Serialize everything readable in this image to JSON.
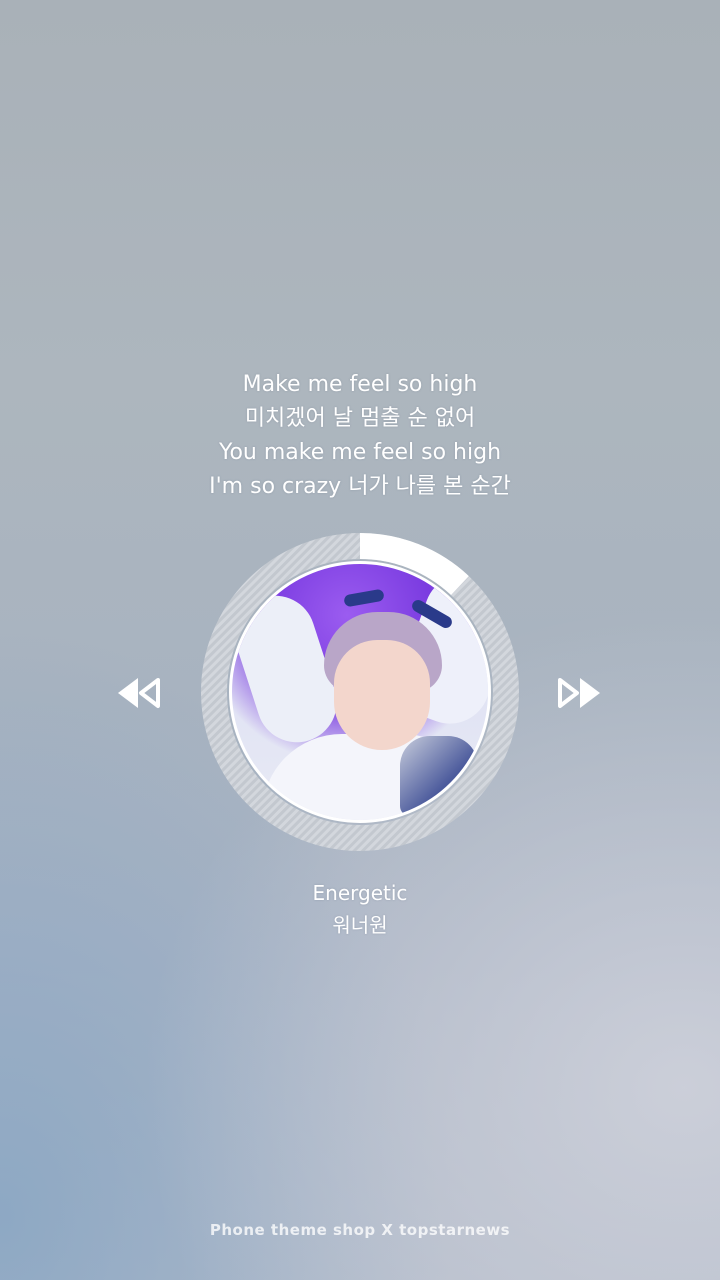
{
  "lyrics": [
    "Make me feel so high",
    "미치겠어 날 멈출 순 없어",
    "You make me feel so high",
    "I'm so crazy 너가 나를 본 순간"
  ],
  "player": {
    "progress": 0.12,
    "ring_color": "#c9ced6",
    "progress_color": "#ffffff",
    "prev_icon": "rewind-icon",
    "next_icon": "fast-forward-icon",
    "album_art": "album-art"
  },
  "song": {
    "title": "Energetic",
    "artist": "워너원"
  },
  "footer": {
    "credit": "Phone theme shop X topstarnews"
  }
}
